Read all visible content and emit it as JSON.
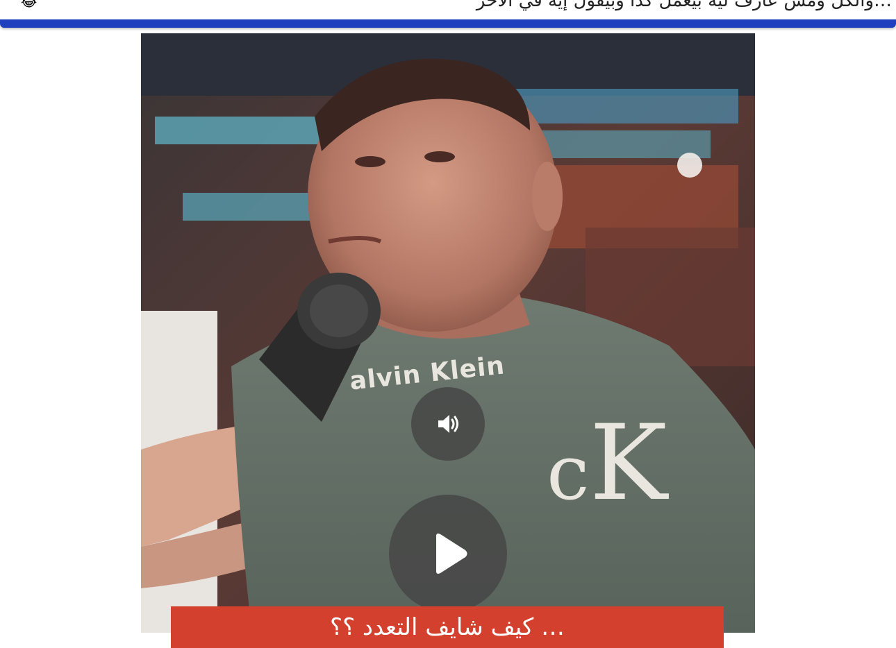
{
  "post": {
    "caption": "…والكل ومش عارف ليه بيعمل كدا وبيقول إيه في الآخر",
    "emoji": "😂"
  },
  "video": {
    "shirt_brand": "alvin Klein",
    "shirt_logo": "CK",
    "subtitle": "… كيف شايف التعدد ؟؟",
    "mute_icon": "speaker-icon",
    "play_icon": "play-icon"
  },
  "colors": {
    "accent_bar": "#1f3fbf",
    "subtitle_bg": "#d4402e",
    "overlay_button": "#464646"
  }
}
